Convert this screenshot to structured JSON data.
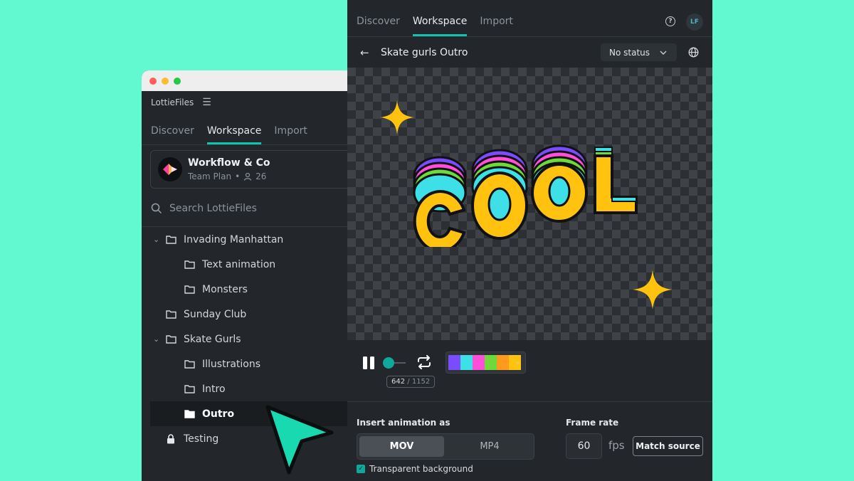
{
  "left_window": {
    "app_name": "LottieFiles",
    "tabs": [
      {
        "label": "Discover"
      },
      {
        "label": "Workspace"
      },
      {
        "label": "Import"
      }
    ],
    "team": {
      "name": "Workflow & Co",
      "plan": "Team Plan",
      "separator": "•",
      "member_count": "26"
    },
    "search": {
      "placeholder": "Search LottieFiles"
    },
    "tree": [
      {
        "label": "Invading Manhattan",
        "level": 0,
        "expanded": true
      },
      {
        "label": "Text animation",
        "level": 1
      },
      {
        "label": "Monsters",
        "level": 1
      },
      {
        "label": "Sunday Club",
        "level": 0
      },
      {
        "label": "Skate Gurls",
        "level": 0,
        "expanded": true
      },
      {
        "label": "Illustrations",
        "level": 1
      },
      {
        "label": "Intro",
        "level": 1
      },
      {
        "label": "Outro",
        "level": 1,
        "selected": true
      },
      {
        "label": "Testing",
        "level": 0,
        "locked": true
      }
    ]
  },
  "right_window": {
    "tabs": [
      {
        "label": "Discover"
      },
      {
        "label": "Workspace"
      },
      {
        "label": "Import"
      }
    ],
    "help_icon": "?",
    "avatar_initials": "LF",
    "page_title": "Skate gurls Outro",
    "status_dropdown": {
      "value": "No status"
    },
    "player": {
      "current_frame": "642",
      "total_frames": "/ 1152",
      "palette": [
        "#7a4cff",
        "#3de0e6",
        "#ff4fd8",
        "#6fd93a",
        "#ff9a1f",
        "#ffc20e"
      ]
    },
    "export": {
      "insert_label": "Insert animation as",
      "formats": [
        {
          "label": "MOV",
          "selected": true
        },
        {
          "label": "MP4",
          "selected": false
        }
      ],
      "transparent_label": "Transparent background",
      "transparent_checked": true,
      "frame_rate_label": "Frame rate",
      "frame_rate_value": "60",
      "fps_unit": "fps",
      "match_source_label": "Match source"
    }
  },
  "colors": {
    "background": "#62f8d0",
    "panel": "#23272b",
    "accent": "#10c4b0",
    "cursor": "#18d9b0"
  }
}
